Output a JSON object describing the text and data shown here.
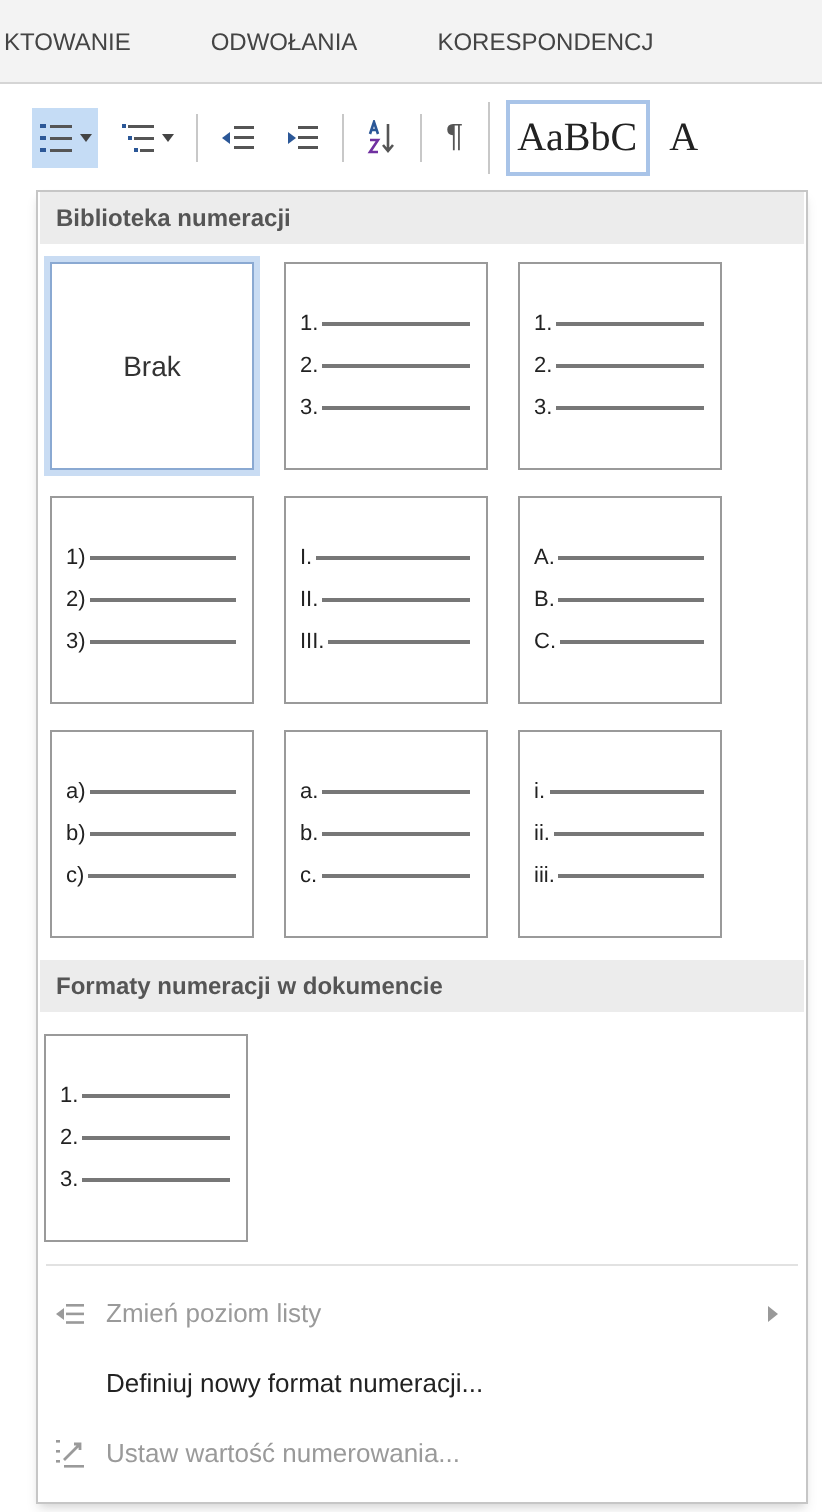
{
  "ribbon_tabs": [
    {
      "label": "KTOWANIE",
      "selected": false
    },
    {
      "label": "ODWOŁANIA",
      "selected": false
    },
    {
      "label": "KORESPONDENCJ",
      "selected": false
    }
  ],
  "toolbar": {
    "buttons": [
      {
        "kind": "numbering",
        "selected": true
      },
      {
        "kind": "multilevel",
        "selected": false
      },
      {
        "kind": "outdent",
        "selected": false
      },
      {
        "kind": "indent",
        "selected": false
      },
      {
        "kind": "sort",
        "selected": false
      }
    ],
    "pilcrow": "¶",
    "styles": [
      "AaBbC",
      "A"
    ]
  },
  "menu": {
    "library_title": "Biblioteka numeracji",
    "library": [
      {
        "kind": "none",
        "label": "Brak",
        "selected": true
      },
      {
        "kind": "list",
        "markers": [
          "1.",
          "2.",
          "3."
        ],
        "selected": false
      },
      {
        "kind": "list",
        "markers": [
          "1.",
          "2.",
          "3."
        ],
        "selected": false
      },
      {
        "kind": "list",
        "markers": [
          "1)",
          "2)",
          "3)"
        ],
        "selected": false
      },
      {
        "kind": "list",
        "markers": [
          "I.",
          "II.",
          "III."
        ],
        "selected": false
      },
      {
        "kind": "list",
        "markers": [
          "A.",
          "B.",
          "C."
        ],
        "selected": false
      },
      {
        "kind": "list",
        "markers": [
          "a)",
          "b)",
          "c)"
        ],
        "selected": false
      },
      {
        "kind": "list",
        "markers": [
          "a.",
          "b.",
          "c."
        ],
        "selected": false
      },
      {
        "kind": "list",
        "markers": [
          "i.",
          "ii.",
          "iii."
        ],
        "selected": false
      }
    ],
    "document_title": "Formaty numeracji w dokumencie",
    "document": [
      {
        "kind": "list",
        "markers": [
          "1.",
          "2.",
          "3."
        ],
        "selected": false
      }
    ],
    "items": [
      {
        "label": "Zmień poziom listy",
        "kind": "outdent",
        "disabled": true,
        "submenu": true
      },
      {
        "label": "Definiuj nowy format numeracji...",
        "kind": "plain",
        "disabled": false,
        "submenu": false
      },
      {
        "label": "Ustaw wartość numerowania...",
        "kind": "set-value",
        "disabled": true,
        "submenu": false
      }
    ]
  }
}
